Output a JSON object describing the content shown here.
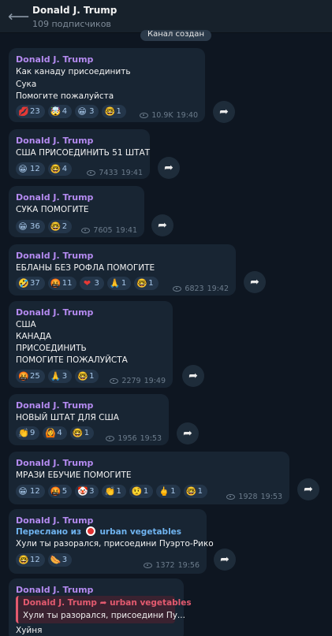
{
  "header": {
    "back_icon": "arrow-left-icon",
    "title": "Donald J. Trump",
    "subtitle": "109 подписчиков"
  },
  "service_message": "Канал создан",
  "messages": [
    {
      "author": "Donald J. Trump",
      "lines": [
        "Как канаду присоединить",
        "Сука",
        "Помогите пожалуйста"
      ],
      "reactions": [
        {
          "emoji": "💋",
          "count": "23"
        },
        {
          "emoji": "🤯",
          "count": "4"
        },
        {
          "emoji": "😁",
          "count": "3"
        },
        {
          "emoji": "🤓",
          "count": "1"
        }
      ],
      "views": "10.9K",
      "time": "19:40"
    },
    {
      "author": "Donald J. Trump",
      "lines": [
        "США ПРИСОЕДИНИТЬ 51 ШТАТ"
      ],
      "reactions": [
        {
          "emoji": "😁",
          "count": "12"
        },
        {
          "emoji": "🤓",
          "count": "4"
        }
      ],
      "views": "7433",
      "time": "19:41"
    },
    {
      "author": "Donald J. Trump",
      "lines": [
        "СУКА ПОМОГИТЕ"
      ],
      "reactions": [
        {
          "emoji": "😁",
          "count": "36"
        },
        {
          "emoji": "🤓",
          "count": "2"
        }
      ],
      "views": "7605",
      "time": "19:41"
    },
    {
      "author": "Donald J. Trump",
      "lines": [
        "ЕБЛАНЫ БЕЗ РОФЛА ПОМОГИТЕ"
      ],
      "reactions": [
        {
          "emoji": "🤣",
          "count": "37"
        },
        {
          "emoji": "🤬",
          "count": "11"
        },
        {
          "emoji": "❤",
          "count": "3"
        },
        {
          "emoji": "🙏",
          "count": "1"
        },
        {
          "emoji": "🤓",
          "count": "1"
        }
      ],
      "views": "6823",
      "time": "19:42"
    },
    {
      "author": "Donald J. Trump",
      "lines": [
        "США",
        "КАНАДА",
        "ПРИСОЕДИНИТЬ",
        "ПОМОГИТЕ ПОЖАЛУЙСТА"
      ],
      "reactions": [
        {
          "emoji": "🤬",
          "count": "25"
        },
        {
          "emoji": "🙏",
          "count": "3"
        },
        {
          "emoji": "🤓",
          "count": "1"
        }
      ],
      "views": "2279",
      "time": "19:49"
    },
    {
      "author": "Donald J. Trump",
      "lines": [
        "НОВЫЙ ШТАТ ДЛЯ США"
      ],
      "reactions": [
        {
          "emoji": "👏",
          "count": "9"
        },
        {
          "emoji": "🙆",
          "count": "4"
        },
        {
          "emoji": "🤓",
          "count": "1"
        }
      ],
      "views": "1956",
      "time": "19:53"
    },
    {
      "author": "Donald J. Trump",
      "lines": [
        "МРАЗИ ЕБУЧИЕ ПОМОГИТЕ"
      ],
      "reactions": [
        {
          "emoji": "😁",
          "count": "12"
        },
        {
          "emoji": "🤬",
          "count": "5"
        },
        {
          "emoji": "🤡",
          "count": "3"
        },
        {
          "emoji": "👏",
          "count": "1"
        },
        {
          "emoji": "🤨",
          "count": "1"
        },
        {
          "emoji": "🖕",
          "count": "1"
        },
        {
          "emoji": "🤓",
          "count": "1"
        }
      ],
      "views": "1928",
      "time": "19:53"
    },
    {
      "author": "Donald J. Trump",
      "forwarded_prefix": "Переслано из",
      "forwarded_from": "urban vegetables",
      "lines": [
        "Хули ты разорался, присоедини Пуэрто-Рико"
      ],
      "reactions": [
        {
          "emoji": "🤓",
          "count": "12"
        },
        {
          "emoji": "🌭",
          "count": "3"
        }
      ],
      "views": "1372",
      "time": "19:56"
    },
    {
      "author": "Donald J. Trump",
      "reply_author": "Donald J. Trump",
      "reply_arrow": "➦",
      "reply_channel": "urban vegetables",
      "reply_text": "Хули ты разорался, присоедини Пу...",
      "lines": [
        "Хуйня"
      ]
    }
  ],
  "share_icon": "➦"
}
